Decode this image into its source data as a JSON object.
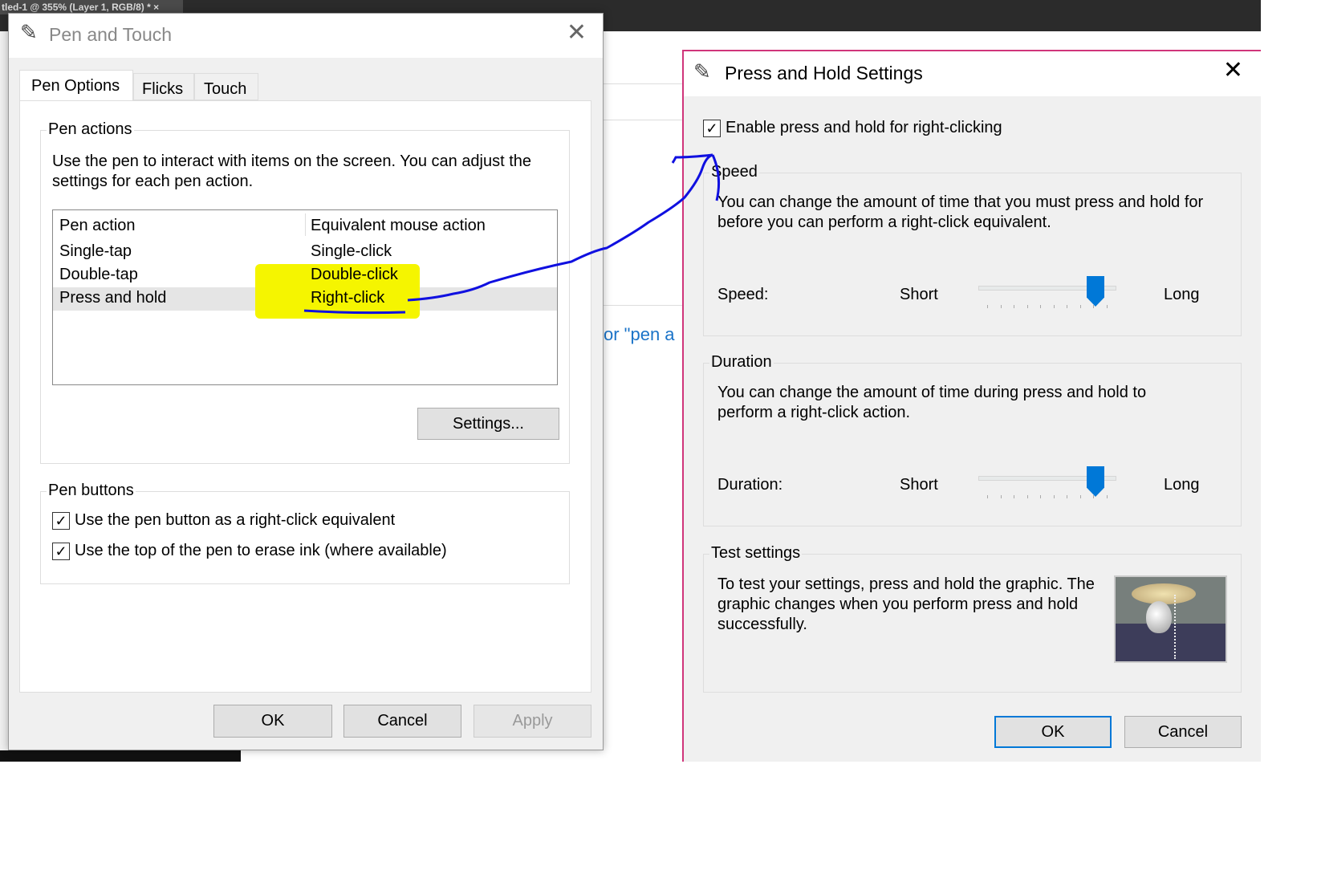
{
  "background": {
    "tab_title": "tled-1 @ 355% (Layer 1, RGB/8) *",
    "tab_close": "×",
    "link_fragment": "or \"pen a"
  },
  "pen_touch": {
    "title": "Pen and Touch",
    "close": "✕",
    "tabs": [
      {
        "label": "Pen Options",
        "active": true
      },
      {
        "label": "Flicks"
      },
      {
        "label": "Touch"
      }
    ],
    "pen_actions": {
      "legend": "Pen actions",
      "description": "Use the pen to interact with items on the screen. You can adjust the settings for each pen action.",
      "columns": [
        "Pen action",
        "Equivalent mouse action"
      ],
      "rows": [
        [
          "Single-tap",
          "Single-click"
        ],
        [
          "Double-tap",
          "Double-click"
        ],
        [
          "Press and hold",
          "Right-click"
        ]
      ],
      "selected_row": 2,
      "settings_button": "Settings..."
    },
    "pen_buttons": {
      "legend": "Pen buttons",
      "options": [
        {
          "label": "Use the pen button as a right-click equivalent",
          "checked": true
        },
        {
          "label": "Use the top of the pen to erase ink (where available)",
          "checked": true
        }
      ]
    },
    "buttons": {
      "ok": "OK",
      "cancel": "Cancel",
      "apply": "Apply"
    }
  },
  "press_hold": {
    "title": "Press and Hold Settings",
    "close": "✕",
    "enable": {
      "label": "Enable press and hold for right-clicking",
      "checked": true
    },
    "speed": {
      "legend": "Speed",
      "description": "You can change the amount of time that you must press and hold for before you can perform a right-click equivalent.",
      "label": "Speed:",
      "min_label": "Short",
      "max_label": "Long",
      "value_fraction": 0.9
    },
    "duration": {
      "legend": "Duration",
      "description": "You can change the amount of time during press and hold to perform a right-click action.",
      "label": "Duration:",
      "min_label": "Short",
      "max_label": "Long",
      "value_fraction": 0.9
    },
    "test": {
      "legend": "Test settings",
      "description": "To test your settings, press and hold the graphic. The graphic changes when you perform press and hold successfully."
    },
    "buttons": {
      "ok": "OK",
      "cancel": "Cancel"
    }
  },
  "colors": {
    "accent": "#0078d7",
    "highlight": "#f5f500",
    "ink": "#1010e0",
    "border_active": "#d0357a"
  }
}
